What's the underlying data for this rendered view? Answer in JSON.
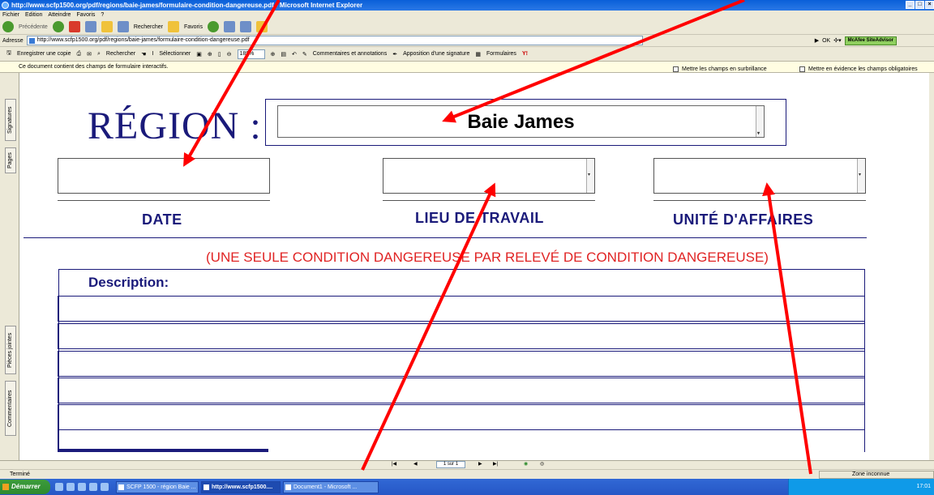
{
  "window": {
    "title": "http://www.scfp1500.org/pdf/regions/baie-james/formulaire-condition-dangereuse.pdf - Microsoft Internet Explorer"
  },
  "menu": [
    "Fichier",
    "Edition",
    "Atteindre",
    "Favoris",
    "?"
  ],
  "toolbar": {
    "back": "Précédente",
    "search": "Rechercher",
    "favorites": "Favoris"
  },
  "address": {
    "label": "Adresse",
    "url": "http://www.scfp1500.org/pdf/regions/baie-james/formulaire-condition-dangereuse.pdf",
    "go": "OK",
    "mcafee": "McAfee SiteAdvisor"
  },
  "acrobat_toolbar": {
    "save_copy": "Enregistrer une copie",
    "search": "Rechercher",
    "select": "Sélectionner",
    "zoom": "189%",
    "comments": "Commentaires et annotations",
    "signature": "Apposition d'une signature",
    "forms": "Formulaires"
  },
  "infobar": {
    "message": "Ce document contient des champs de formulaire interactifs.",
    "highlight_fields": "Mettre les champs en surbrillance",
    "highlight_required": "Mettre en évidence les champs obligatoires"
  },
  "side_tabs": [
    "Signatures",
    "Pages",
    "Pièces jointes",
    "Commentaires"
  ],
  "form": {
    "region_label": "RÉGION :",
    "region_value": "Baie James",
    "date_label": "DATE",
    "workplace_label": "LIEU DE TRAVAIL",
    "business_unit_label": "UNITÉ D'AFFAIRES",
    "notice": "(UNE SEULE CONDITION DANGEREUSE PAR RELEVÉ DE CONDITION DANGEREUSE)",
    "description_label": "Description:"
  },
  "page_nav": {
    "page_indicator": "1 sur 1"
  },
  "status": {
    "text": "Terminé",
    "zone": "Zone inconnue"
  },
  "taskbar": {
    "start": "Démarrer",
    "items": [
      "SCFP 1500 - région Baie ...",
      "http://www.scfp1500....",
      "Document1 - Microsoft ..."
    ],
    "clock": "17:01"
  },
  "colors": {
    "form_blue": "#1a1a7a",
    "notice_red": "#e02424",
    "arrow_red": "#ff0000"
  }
}
